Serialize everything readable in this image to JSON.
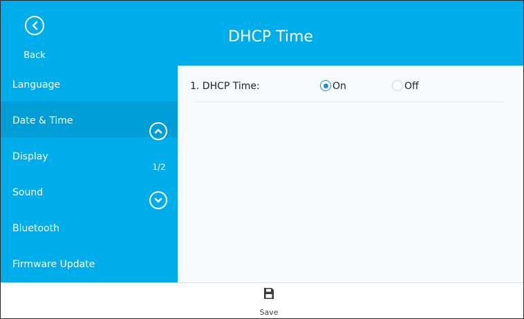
{
  "header": {
    "title": "DHCP Time",
    "back_label": "Back",
    "back_icon": "chevron-left-icon"
  },
  "sidebar": {
    "items": [
      {
        "label": "Language",
        "selected": false
      },
      {
        "label": "Date & Time",
        "selected": true
      },
      {
        "label": "Display",
        "selected": false
      },
      {
        "label": "Sound",
        "selected": false
      },
      {
        "label": "Bluetooth",
        "selected": false
      },
      {
        "label": "Firmware Update",
        "selected": false
      }
    ],
    "page_indicator": "1/2",
    "scroll_up_icon": "chevron-up-icon",
    "scroll_down_icon": "chevron-down-icon"
  },
  "setting": {
    "label": "1. DHCP Time:",
    "options": [
      {
        "label": "On",
        "checked": true
      },
      {
        "label": "Off",
        "checked": false
      }
    ]
  },
  "bottom_bar": {
    "save_label": "Save",
    "save_icon": "floppy-disk-icon"
  },
  "colors": {
    "accent": "#00adeb",
    "selected_item": "#009dd6",
    "radio_checked": "#1b8fd1",
    "content_bg": "#f7fbfd"
  }
}
